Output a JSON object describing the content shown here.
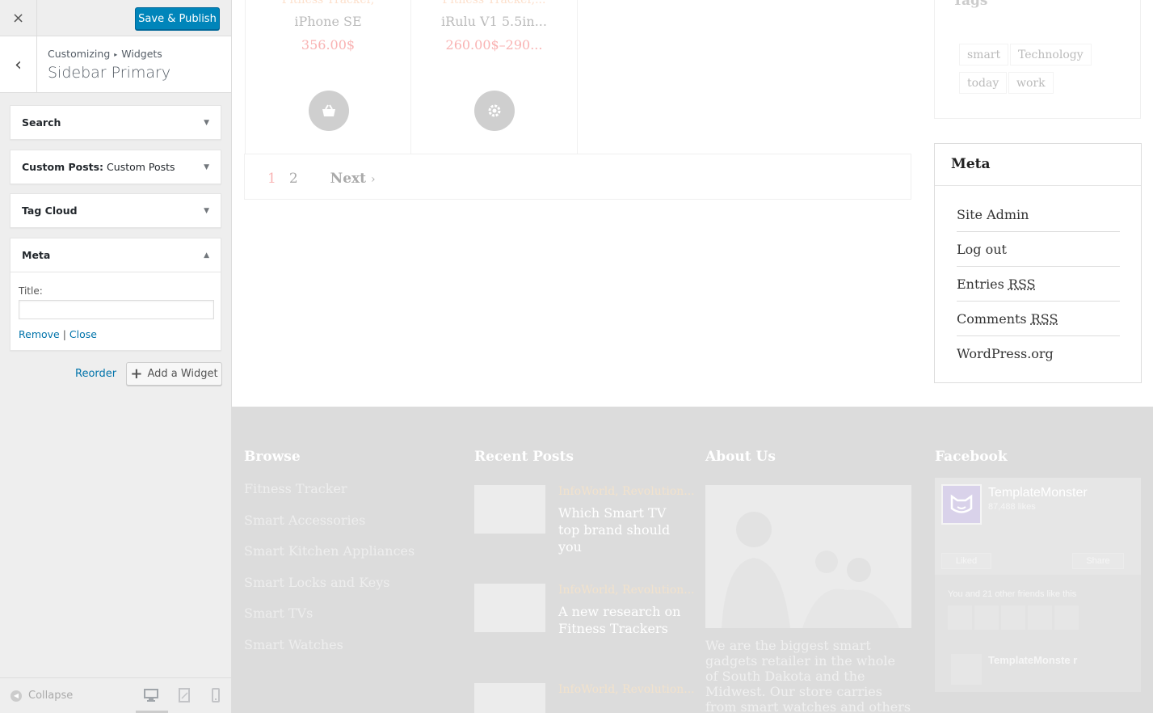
{
  "customizer": {
    "close_icon": "×",
    "publish_label": "Save & Publish",
    "back_icon": "‹",
    "breadcrumb": [
      "Customizing",
      "Widgets"
    ],
    "breadcrumb_sep": "▸",
    "section_title": "Sidebar Primary",
    "widgets": [
      {
        "name": "Search",
        "sub": "",
        "expanded": false
      },
      {
        "name": "Custom Posts:",
        "sub": "Custom Posts",
        "expanded": false
      },
      {
        "name": "Tag Cloud",
        "sub": "",
        "expanded": false
      },
      {
        "name": "Meta",
        "sub": "",
        "expanded": true
      }
    ],
    "meta_form": {
      "title_label": "Title:",
      "title_value": "",
      "remove_label": "Remove",
      "sep": "|",
      "close_label": "Close"
    },
    "reorder_label": "Reorder",
    "add_widget_label": "Add a Widget",
    "collapse_label": "Collapse",
    "accent_color": "#0085ba",
    "link_color": "#0073aa"
  },
  "preview": {
    "products": [
      {
        "category": "Fitness Tracker,",
        "name": "iPhone SE",
        "price": "356.00$",
        "button_icon": "basket-icon"
      },
      {
        "category": "Fitness Tracker,...",
        "name": "iRulu V1 5.5in...",
        "price": "260.00$–290...",
        "button_icon": "gear-icon"
      }
    ],
    "pagination": {
      "current": "1",
      "page2": "2",
      "next": "Next",
      "next_chevron": "›"
    },
    "tags": {
      "title": "Tags",
      "items": [
        "smart",
        "Technology",
        "today",
        "work"
      ]
    },
    "meta_widget": {
      "title": "Meta",
      "links": [
        {
          "text": "Site Admin",
          "abbr": ""
        },
        {
          "text": "Log out",
          "abbr": ""
        },
        {
          "text": "Entries ",
          "abbr": "RSS"
        },
        {
          "text": "Comments ",
          "abbr": "RSS"
        },
        {
          "text": "WordPress.org",
          "abbr": ""
        }
      ]
    },
    "footer": {
      "browse_title": "Browse",
      "browse_items": [
        "Fitness Tracker",
        "Smart Accessories",
        "Smart Kitchen Appliances",
        "Smart Locks and Keys",
        "Smart TVs",
        "Smart Watches"
      ],
      "recent_title": "Recent Posts",
      "recent_posts": [
        {
          "category": "InfoWorld, Revolution...",
          "title": "Which Smart TV top brand should you"
        },
        {
          "category": "InfoWorld, Revolution...",
          "title": "A new research on Fitness Trackers"
        },
        {
          "category": "InfoWorld, Revolution...",
          "title": ""
        }
      ],
      "about_title": "About Us",
      "about_text": "We are the biggest smart gadgets retailer in the whole of South Dakota and the Midwest. Our store carries from smart watches and others trending gadgets",
      "facebook_title": "Facebook",
      "facebook": {
        "page_name": "TemplateMonster",
        "likes": "87,488 likes",
        "liked_label": "Liked",
        "share_label": "Share",
        "friends_text": "You and 21 other friends like this",
        "post_name": "TemplateMonste r"
      }
    }
  }
}
